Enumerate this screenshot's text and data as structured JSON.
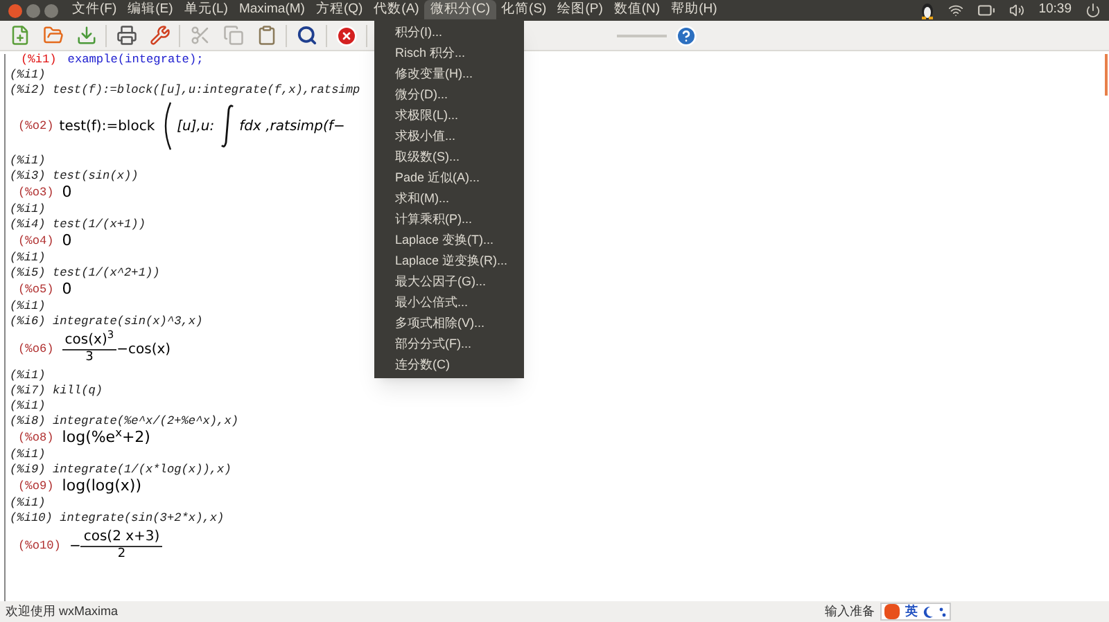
{
  "menubar": {
    "items": [
      {
        "label": "文件(F)",
        "selected": false
      },
      {
        "label": "编辑(E)",
        "selected": false
      },
      {
        "label": "单元(L)",
        "selected": false
      },
      {
        "label": "Maxima(M)",
        "selected": false
      },
      {
        "label": "方程(Q)",
        "selected": false
      },
      {
        "label": "代数(A)",
        "selected": false
      },
      {
        "label": "微积分(C)",
        "selected": true
      },
      {
        "label": "化简(S)",
        "selected": false
      },
      {
        "label": "绘图(P)",
        "selected": false
      },
      {
        "label": "数值(N)",
        "selected": false
      },
      {
        "label": "帮助(H)",
        "selected": false
      }
    ],
    "clock": "10:39"
  },
  "dropdown": {
    "items": [
      "积分(I)...",
      "Risch 积分...",
      "修改变量(H)...",
      "微分(D)...",
      "求极限(L)...",
      "求极小值...",
      "取级数(S)...",
      "Pade 近似(A)...",
      "求和(M)...",
      "计算乘积(P)...",
      "Laplace 变换(T)...",
      "Laplace 逆变换(R)...",
      "最大公因子(G)...",
      "最小公倍式...",
      "多项式相除(V)...",
      "部分分式(F)...",
      "连分数(C)"
    ]
  },
  "worksheet": {
    "lines": [
      {
        "kind": "prompt",
        "label": "(%i1)",
        "text": "example(integrate);"
      },
      {
        "kind": "input",
        "text": "(%i1)"
      },
      {
        "kind": "input",
        "text": "(%i2) test(f):=block([u],u:integrate(f,x),ratsimp"
      },
      {
        "kind": "integral",
        "label": "(%o2)",
        "before": "test(f):=block",
        "middle": "[u],u:",
        "after": "fdx ,ratsimp(f−"
      },
      {
        "kind": "input",
        "text": "(%i1)"
      },
      {
        "kind": "input",
        "text": "(%i3) test(sin(x))"
      },
      {
        "kind": "output",
        "label": "(%o3)",
        "text": "0"
      },
      {
        "kind": "input",
        "text": "(%i1)"
      },
      {
        "kind": "input",
        "text": "(%i4) test(1/(x+1))"
      },
      {
        "kind": "output",
        "label": "(%o4)",
        "text": "0"
      },
      {
        "kind": "input",
        "text": "(%i1)"
      },
      {
        "kind": "input",
        "text": "(%i5) test(1/(x^2+1))"
      },
      {
        "kind": "output",
        "label": "(%o5)",
        "text": "0"
      },
      {
        "kind": "input",
        "text": "(%i1)"
      },
      {
        "kind": "input",
        "text": "(%i6) integrate(sin(x)^3,x)"
      },
      {
        "kind": "fraction",
        "label": "(%o6)",
        "numerator": "cos(x)$^{3}$",
        "denominator": "3",
        "after": "−cos(x)"
      },
      {
        "kind": "input",
        "text": "(%i1)"
      },
      {
        "kind": "input",
        "text": "(%i7) kill(q)"
      },
      {
        "kind": "input",
        "text": "(%i1)"
      },
      {
        "kind": "input",
        "text": "(%i8) integrate(%e^x/(2+%e^x),x)"
      },
      {
        "kind": "output",
        "label": "(%o8)",
        "text": "log(%e$^{x}$+2)"
      },
      {
        "kind": "input",
        "text": "(%i1)"
      },
      {
        "kind": "input",
        "text": "(%i9) integrate(1/(x*log(x)),x)"
      },
      {
        "kind": "output",
        "label": "(%o9)",
        "text": "log(log(x))"
      },
      {
        "kind": "input",
        "text": "(%i1)"
      },
      {
        "kind": "input",
        "text": "(%i10) integrate(sin(3+2*x),x)"
      },
      {
        "kind": "fraction",
        "label": "(%o10)",
        "prefix": "−",
        "numerator": "cos(2 x+3)",
        "denominator": "2"
      }
    ]
  },
  "status_bar": {
    "message": "欢迎使用 wxMaxima",
    "ime_status": "输入准备",
    "ime_label": "英"
  }
}
